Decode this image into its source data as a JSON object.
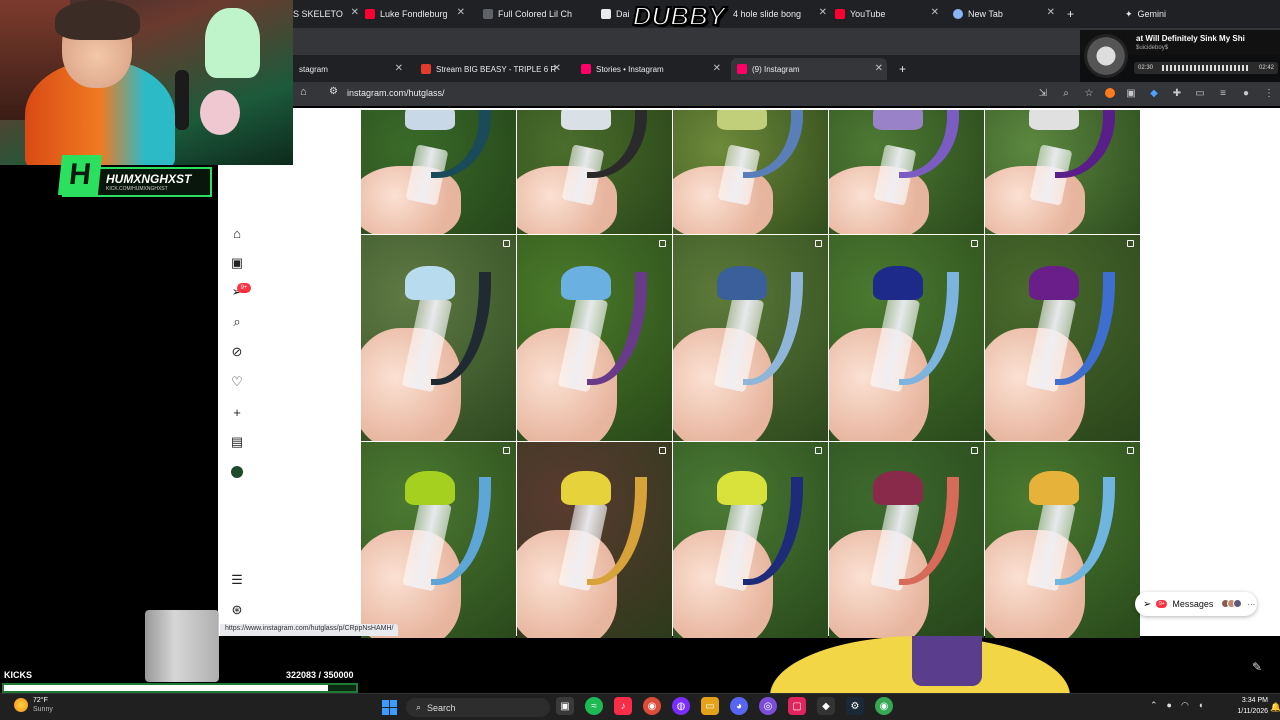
{
  "overlay_logo": "DUBBY",
  "streamer": {
    "name": "HUMXNGHXST",
    "subtitle": "KICK.COM/HUMXNGHXST"
  },
  "top_window": {
    "tabs": [
      {
        "label": "S SKELETO",
        "favicon_color": "#e53935"
      },
      {
        "label": "Luke Fondleburg",
        "favicon_color": "#ff0033"
      },
      {
        "label": "Full Colored Lil Ch",
        "favicon_color": "#5f6368"
      },
      {
        "label": "Dai",
        "favicon_color": "#e8eaed"
      },
      {
        "label": "4 hole slide bong",
        "favicon_color": "#5f6368"
      },
      {
        "label": "YouTube",
        "favicon_color": "#ff0033"
      },
      {
        "label": "New Tab",
        "favicon_color": "#8ab4f8"
      }
    ],
    "new_tab": "+",
    "gemini": "Gemini"
  },
  "browser": {
    "tabs": [
      {
        "label": "stagram",
        "favicon_color": "#ff0069"
      },
      {
        "label": "Stream BIG BEASY - TRIPLE 6 R",
        "favicon_color": "#e53b2c"
      },
      {
        "label": "Stories • Instagram",
        "favicon_color": "#ff0069"
      },
      {
        "label": "(9) Instagram",
        "favicon_color": "#ff0069"
      }
    ],
    "new_tab": "+",
    "url": "instagram.com/hutglass/"
  },
  "instagram": {
    "nav_icons": [
      "home-icon",
      "reels-icon",
      "direct-icon",
      "search-icon",
      "explore-icon",
      "heart-icon",
      "create-icon",
      "insights-icon",
      "profile-icon"
    ],
    "direct_badge": "9+",
    "bottom_icons": [
      "menu-icon",
      "threads-icon"
    ],
    "messages_label": "Messages",
    "messages_badge": "9+",
    "grid": [
      {
        "bg": "#3a6b2a",
        "bowl": "#c9d8e6",
        "horn": "#1b4a5a"
      },
      {
        "bg": "#4b6e2c",
        "bowl": "#d9e0e6",
        "horn": "#2a2a2a"
      },
      {
        "bg": "#6e8a3a",
        "bowl": "#c2cf7a",
        "horn": "#5a7fb8"
      },
      {
        "bg": "#4e7a34",
        "bowl": "#9a82c8",
        "horn": "#7a5cc2"
      },
      {
        "bg": "#5c8840",
        "bowl": "#e0e0e0",
        "horn": "#5a1e8a"
      },
      {
        "bg": "#5f7a44",
        "bowl": "#b8dcee",
        "horn": "#1f2a33"
      },
      {
        "bg": "#4a7a2a",
        "bowl": "#6ab0e0",
        "horn": "#6a3a8a"
      },
      {
        "bg": "#5d7a3a",
        "bowl": "#3a5f9a",
        "horn": "#8fb5d8"
      },
      {
        "bg": "#4b7a30",
        "bowl": "#1e2a8a",
        "horn": "#7db4df"
      },
      {
        "bg": "#4a6a2e",
        "bowl": "#6a1e8a",
        "horn": "#3e6fd0"
      },
      {
        "bg": "#4c7a32",
        "bowl": "#a6d020",
        "horn": "#5fa6d8"
      },
      {
        "bg": "#5a3a30",
        "bowl": "#e6d23a",
        "horn": "#d8a23a"
      },
      {
        "bg": "#4a7a34",
        "bowl": "#d8e23a",
        "horn": "#1e2a7a"
      },
      {
        "bg": "#3e6a2e",
        "bowl": "#8a2a4a",
        "horn": "#d86a5a"
      },
      {
        "bg": "#4a7a30",
        "bowl": "#e6b23a",
        "horn": "#6fb5df"
      }
    ]
  },
  "status_url": "https://www.instagram.com/hutglass/p/CRppNsHAMH/",
  "now_playing": {
    "title": "at Will Definitely Sink My Shi",
    "artist": "$uicideboy$",
    "elapsed": "02:30",
    "total": "02:42"
  },
  "kicks": {
    "label": "KICKS",
    "current": 322083,
    "goal": 350000,
    "count_text": "322083  / 350000"
  },
  "taskbar": {
    "weather_temp": "72°F",
    "weather_desc": "Sunny",
    "search_placeholder": "Search",
    "time": "3:34 PM",
    "date": "1/11/2026"
  }
}
